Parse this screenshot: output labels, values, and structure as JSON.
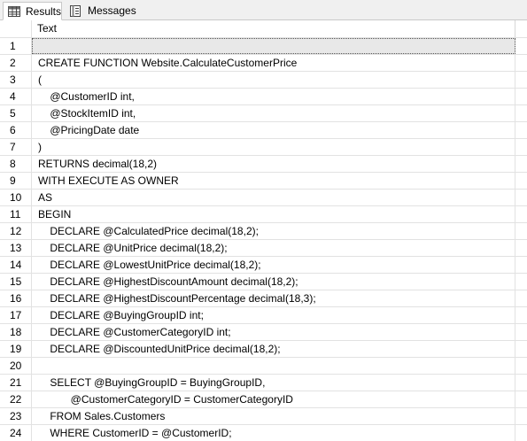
{
  "tabs": [
    {
      "label": "Results",
      "icon": "grid-icon",
      "active": true
    },
    {
      "label": "Messages",
      "icon": "messages-icon",
      "active": false
    }
  ],
  "grid": {
    "column_header": "Text",
    "rows": [
      {
        "num": "1",
        "text": ""
      },
      {
        "num": "2",
        "text": "CREATE FUNCTION Website.CalculateCustomerPrice"
      },
      {
        "num": "3",
        "text": "("
      },
      {
        "num": "4",
        "text": "    @CustomerID int,"
      },
      {
        "num": "5",
        "text": "    @StockItemID int,"
      },
      {
        "num": "6",
        "text": "    @PricingDate date"
      },
      {
        "num": "7",
        "text": ")"
      },
      {
        "num": "8",
        "text": "RETURNS decimal(18,2)"
      },
      {
        "num": "9",
        "text": "WITH EXECUTE AS OWNER"
      },
      {
        "num": "10",
        "text": "AS"
      },
      {
        "num": "11",
        "text": "BEGIN"
      },
      {
        "num": "12",
        "text": "    DECLARE @CalculatedPrice decimal(18,2);"
      },
      {
        "num": "13",
        "text": "    DECLARE @UnitPrice decimal(18,2);"
      },
      {
        "num": "14",
        "text": "    DECLARE @LowestUnitPrice decimal(18,2);"
      },
      {
        "num": "15",
        "text": "    DECLARE @HighestDiscountAmount decimal(18,2);"
      },
      {
        "num": "16",
        "text": "    DECLARE @HighestDiscountPercentage decimal(18,3);"
      },
      {
        "num": "17",
        "text": "    DECLARE @BuyingGroupID int;"
      },
      {
        "num": "18",
        "text": "    DECLARE @CustomerCategoryID int;"
      },
      {
        "num": "19",
        "text": "    DECLARE @DiscountedUnitPrice decimal(18,2);"
      },
      {
        "num": "20",
        "text": ""
      },
      {
        "num": "21",
        "text": "    SELECT @BuyingGroupID = BuyingGroupID,"
      },
      {
        "num": "22",
        "text": "           @CustomerCategoryID = CustomerCategoryID"
      },
      {
        "num": "23",
        "text": "    FROM Sales.Customers"
      },
      {
        "num": "24",
        "text": "    WHERE CustomerID = @CustomerID;"
      }
    ]
  }
}
